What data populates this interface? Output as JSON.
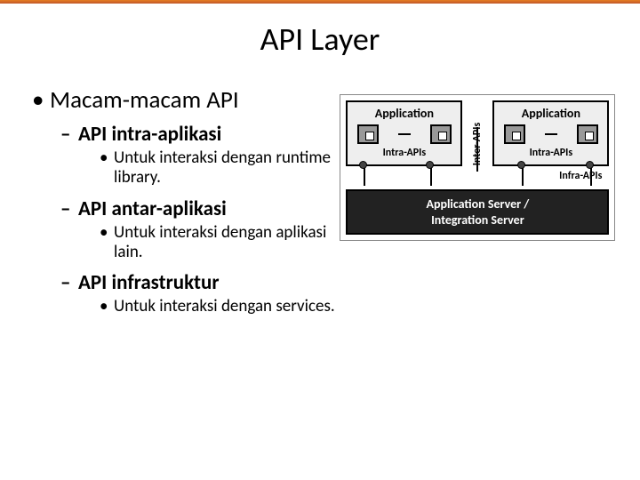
{
  "title": "API Layer",
  "l1": "Macam-macam API",
  "sections": [
    {
      "heading": "API intra-aplikasi",
      "desc": "Untuk interaksi dengan runtime library."
    },
    {
      "heading": "API antar-aplikasi",
      "desc": "Untuk interaksi dengan aplikasi lain."
    },
    {
      "heading": "API infrastruktur",
      "desc": "Untuk interaksi dengan services."
    }
  ],
  "diagram": {
    "app_label": "Application",
    "intra_label": "Intra-APIs",
    "inter_label": "Inter-APIs",
    "infra_label": "Infra-APIs",
    "server_line1": "Application Server /",
    "server_line2": "Integration Server"
  }
}
